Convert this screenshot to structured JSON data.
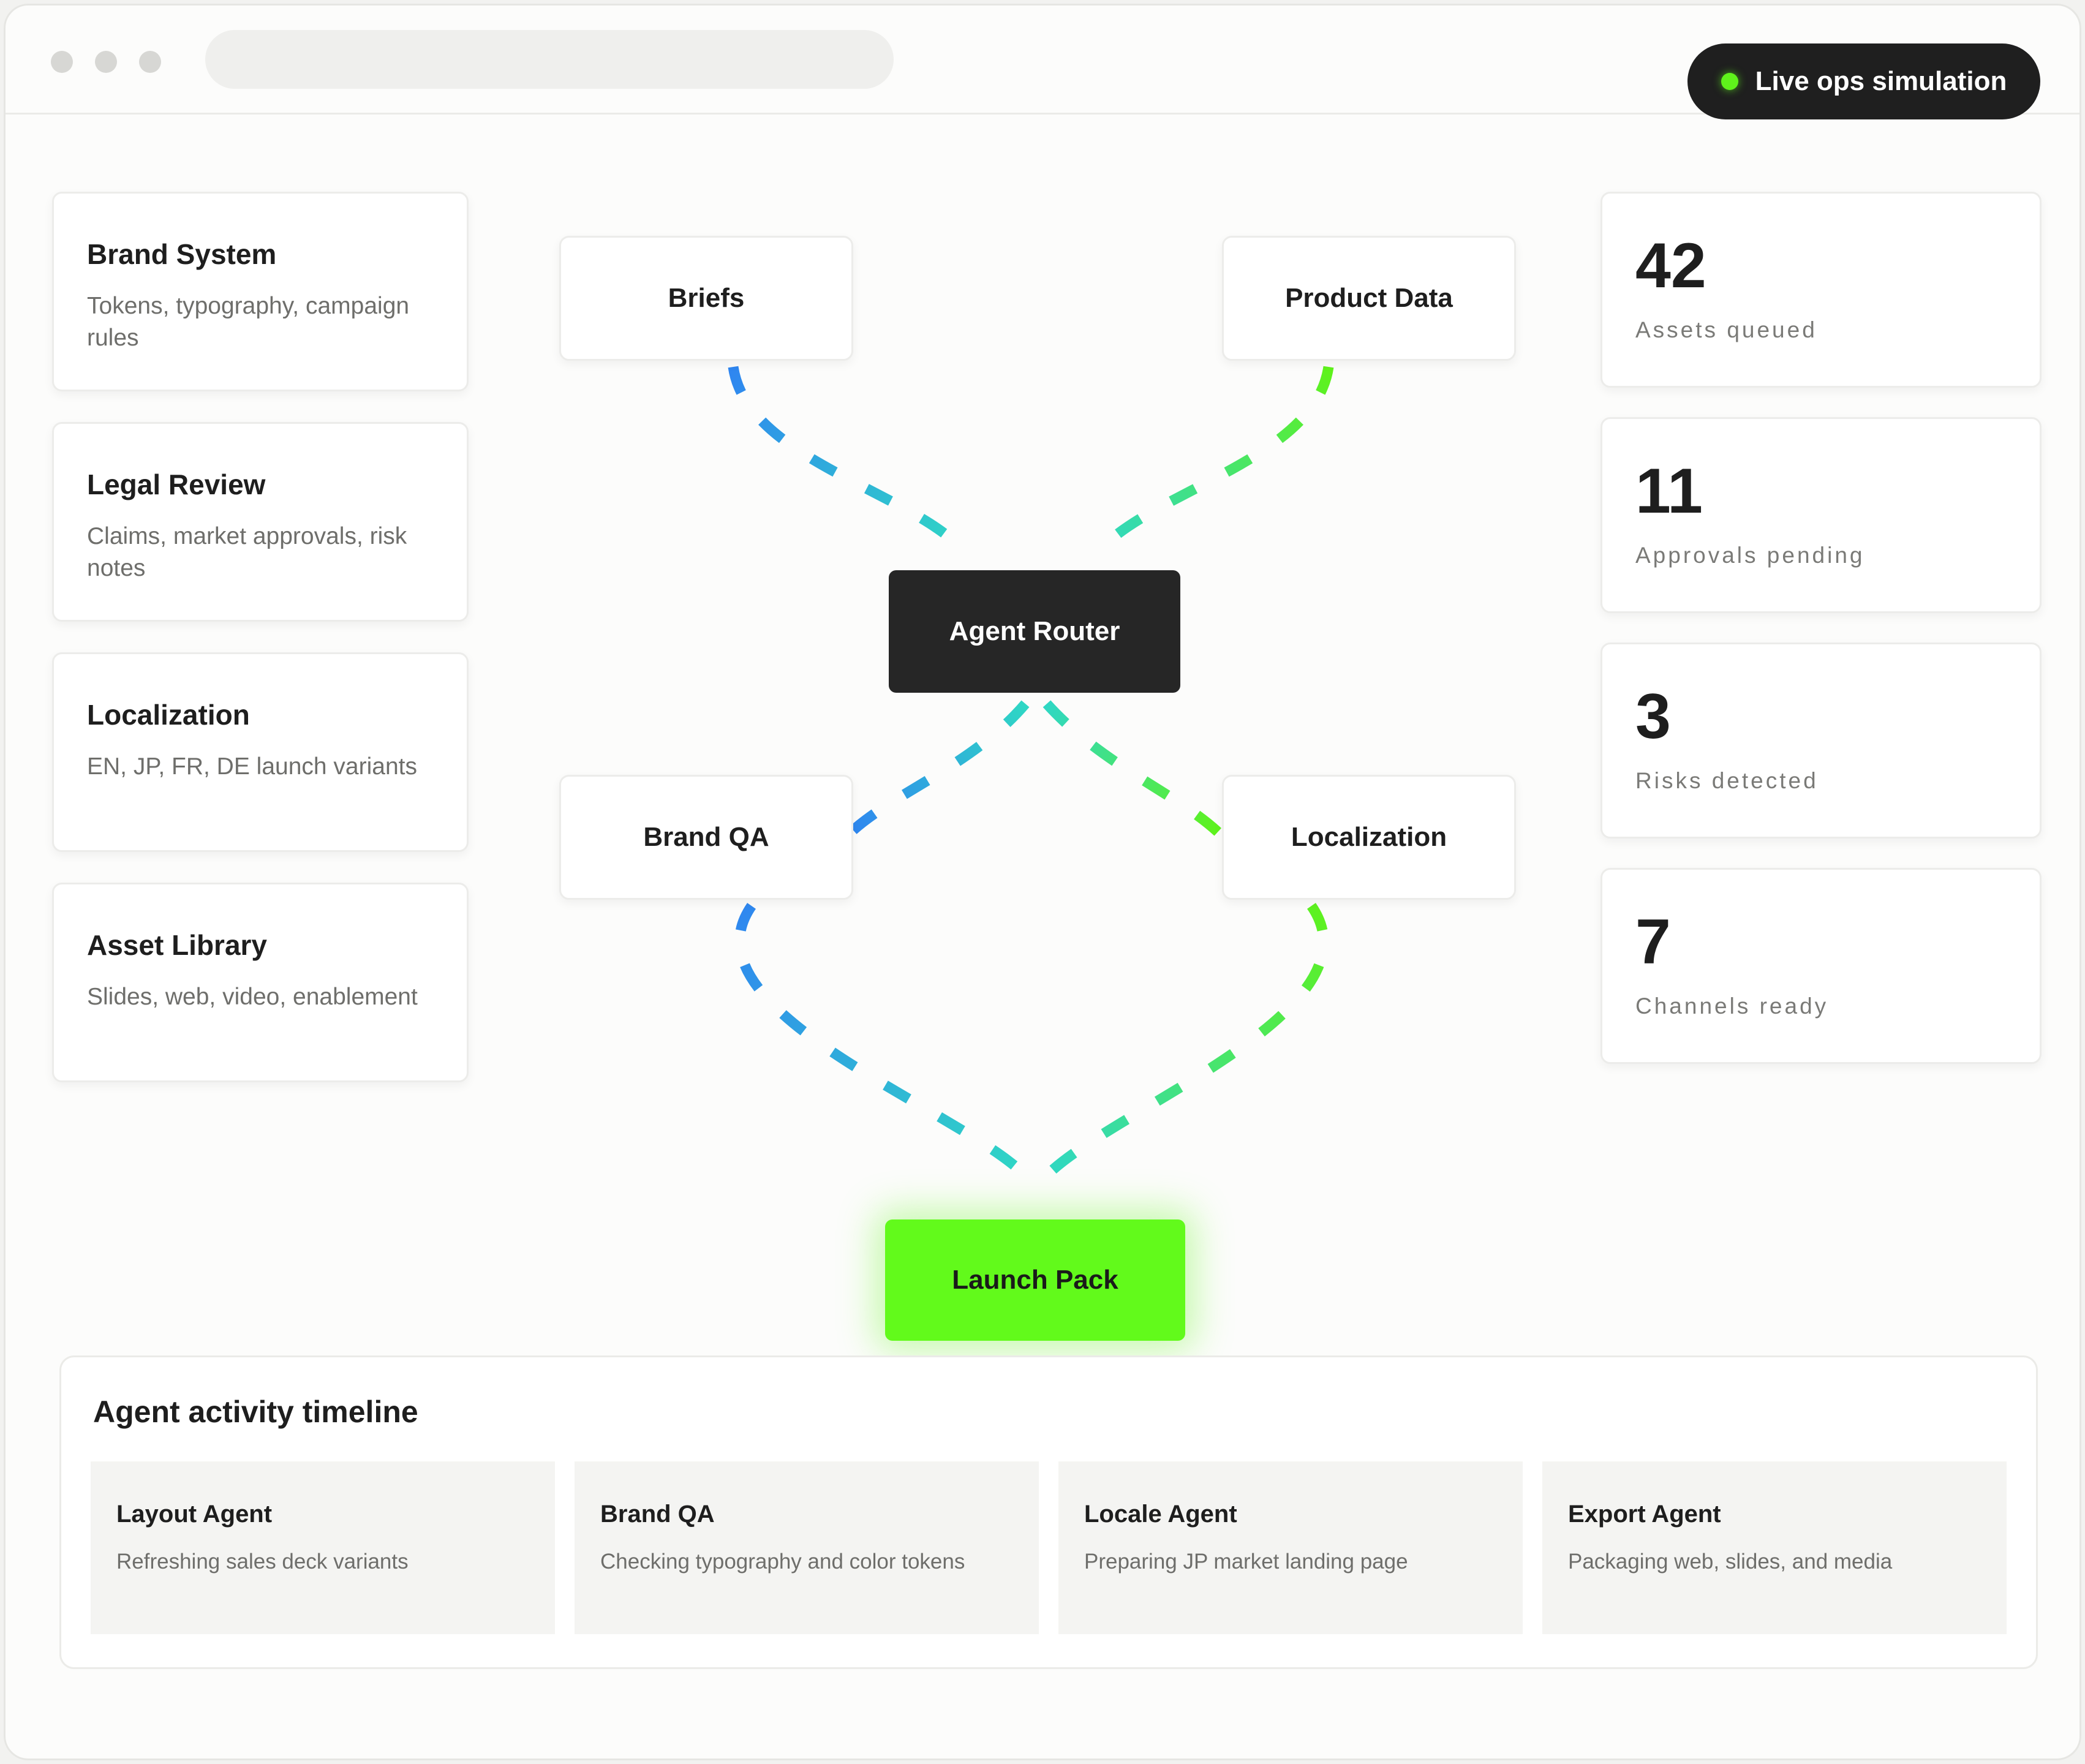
{
  "status_pill": {
    "label": "Live ops simulation",
    "dot_color": "#5ff21b"
  },
  "sources": [
    {
      "title": "Brand System",
      "desc": "Tokens, typography, campaign rules"
    },
    {
      "title": "Legal Review",
      "desc": "Claims, market approvals, risk notes"
    },
    {
      "title": "Localization",
      "desc": "EN, JP, FR, DE launch variants"
    },
    {
      "title": "Asset Library",
      "desc": "Slides, web, video, enablement"
    }
  ],
  "flow": {
    "briefs": "Briefs",
    "product_data": "Product Data",
    "router": "Agent Router",
    "brand_qa": "Brand QA",
    "localization": "Localization",
    "launch": "Launch Pack",
    "edge_colors": {
      "blue": "#2f86f0",
      "teal": "#2fd7c4",
      "green": "#5ff21b"
    }
  },
  "stats": [
    {
      "value": "42",
      "label": "Assets queued"
    },
    {
      "value": "11",
      "label": "Approvals pending"
    },
    {
      "value": "3",
      "label": "Risks detected"
    },
    {
      "value": "7",
      "label": "Channels ready"
    }
  ],
  "timeline": {
    "title": "Agent activity timeline",
    "items": [
      {
        "name": "Layout Agent",
        "desc": "Refreshing sales deck variants"
      },
      {
        "name": "Brand QA",
        "desc": "Checking typography and color tokens"
      },
      {
        "name": "Locale Agent",
        "desc": "Preparing JP market landing page"
      },
      {
        "name": "Export Agent",
        "desc": "Packaging web, slides, and media"
      }
    ]
  }
}
